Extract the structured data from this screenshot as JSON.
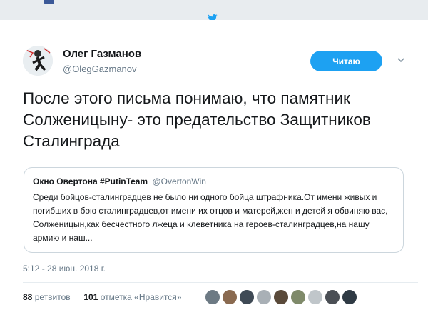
{
  "tweet": {
    "author": {
      "display_name": "Олег Газманов",
      "handle": "@OlegGazmanov",
      "avatar_icon": "avatar-man-running-icon"
    },
    "follow_button": {
      "label": "Читаю",
      "color": "#1da1f2"
    },
    "text": "После этого письма понимаю, что памятник Солженицыну- это предательство Защитников Сталинграда",
    "quoted_tweet": {
      "author_name": "Окно Овертона #PutinTeam",
      "author_handle": "@OvertonWin",
      "text": "Среди бойцов-сталинградцев не было ни одного бойца штрафника.От имени живых и погибших в бою сталинградцев,от имени их отцов и матерей,жен и детей я обвиняю вас, Солженицын,как бесчестного лжеца и клеветника на героев-сталинградцев,на нашу армию и наш..."
    },
    "timestamp": "5:12 - 28 июн. 2018 г.",
    "stats": {
      "retweets_count": "88",
      "retweets_label": "ретвитов",
      "likes_count": "101",
      "likes_label": "отметка «Нравится»"
    },
    "liker_avatars": [
      {
        "icon": "liker-avatar-icon",
        "color": "#6d7a84"
      },
      {
        "icon": "liker-avatar-icon",
        "color": "#8a6a50"
      },
      {
        "icon": "liker-avatar-icon",
        "color": "#3f4a55"
      },
      {
        "icon": "liker-avatar-icon",
        "color": "#a9b0b6"
      },
      {
        "icon": "liker-avatar-icon",
        "color": "#5a4a3a"
      },
      {
        "icon": "liker-avatar-icon",
        "color": "#7f8a6a"
      },
      {
        "icon": "liker-avatar-icon",
        "color": "#c0c6ca"
      },
      {
        "icon": "liker-avatar-icon",
        "color": "#4b4f55"
      },
      {
        "icon": "liker-avatar-icon",
        "color": "#2f3a44"
      }
    ]
  },
  "chrome": {
    "facebook_icon": "facebook-icon",
    "twitter_icon": "twitter-bird-icon",
    "more_icon": "chevron-down-icon"
  }
}
